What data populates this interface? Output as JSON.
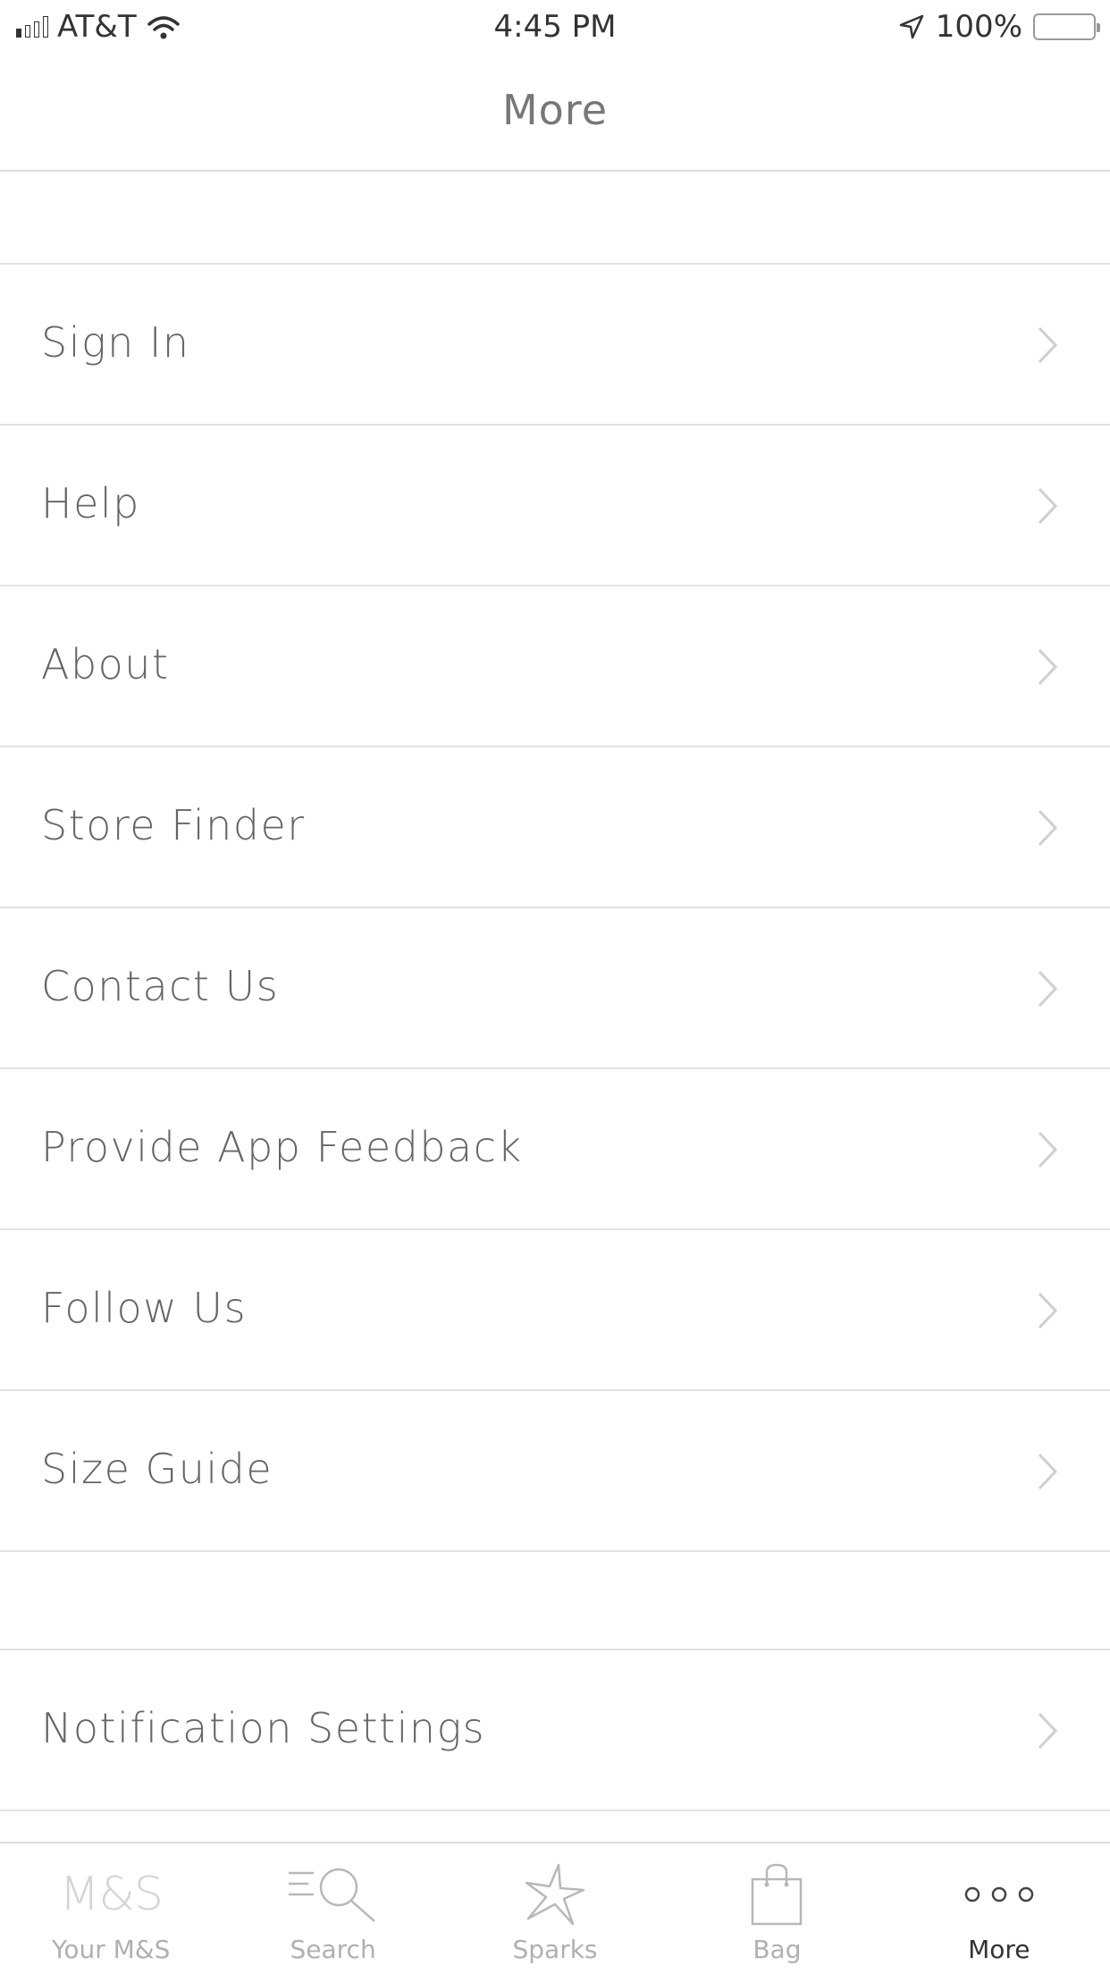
{
  "status_bar": {
    "carrier": "AT&T",
    "time": "4:45 PM",
    "battery": "100%"
  },
  "nav": {
    "title": "More"
  },
  "menu": {
    "items": [
      {
        "label": "Sign In"
      },
      {
        "label": "Help"
      },
      {
        "label": "About"
      },
      {
        "label": "Store Finder"
      },
      {
        "label": "Contact Us"
      },
      {
        "label": "Provide App Feedback"
      },
      {
        "label": "Follow Us"
      },
      {
        "label": "Size Guide"
      }
    ],
    "secondary_items": [
      {
        "label": "Notification Settings"
      }
    ]
  },
  "tab_bar": {
    "tabs": [
      {
        "label": "Your M&S",
        "icon": "ms-logo-icon",
        "logo_text": "M&S"
      },
      {
        "label": "Search",
        "icon": "search-icon"
      },
      {
        "label": "Sparks",
        "icon": "star-icon"
      },
      {
        "label": "Bag",
        "icon": "bag-icon"
      },
      {
        "label": "More",
        "icon": "more-dots-icon",
        "active": true
      }
    ]
  },
  "colors": {
    "active_tab": "#333333",
    "inactive_tab": "#b0b0b0",
    "divider": "#e2e2e2",
    "text": "#666666"
  }
}
